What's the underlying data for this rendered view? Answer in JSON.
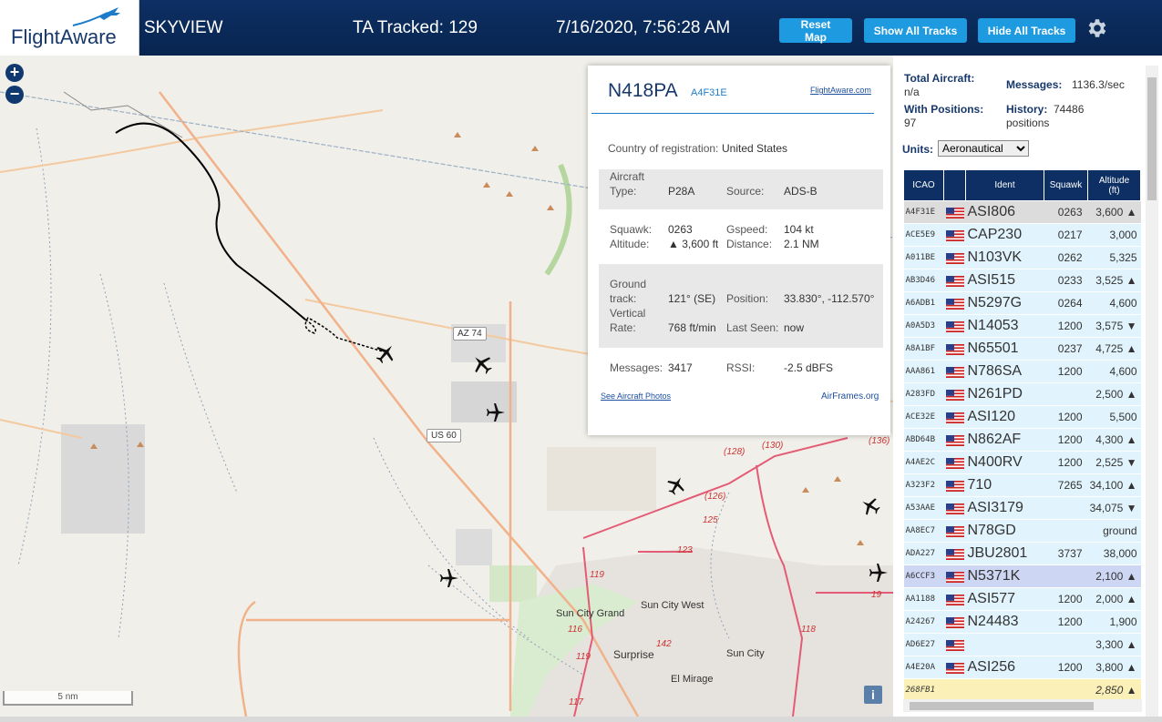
{
  "header": {
    "logo_text": "FlightAware",
    "app_title": "SKYVIEW",
    "tracked_label": "TA Tracked: 129",
    "datetime": "7/16/2020, 7:56:28 AM",
    "reset_map": "Reset Map",
    "show_all_tracks": "Show All Tracks",
    "hide_all_tracks": "Hide All Tracks",
    "settings_icon": "gear-icon"
  },
  "map": {
    "zoom_in": "+",
    "zoom_out": "−",
    "scale_label": "5 nm",
    "info_button": "i",
    "shields": [
      "AZ 74",
      "US 60"
    ],
    "route_labels": [
      "(128)",
      "(130)",
      "(136)",
      "(126)",
      "125",
      "123",
      "119",
      "116",
      "118",
      "142",
      "119",
      "117",
      "19"
    ],
    "place_labels": [
      "Sun City West",
      "Sun City Grand",
      "Surprise",
      "Sun City",
      "El Mirage"
    ]
  },
  "popup": {
    "ident": "N418PA",
    "hex": "A4F31E",
    "link": "FlightAware.com",
    "country_label": "Country of registration:",
    "country_value": "United States",
    "aircraft_type_label": "Aircraft Type:",
    "aircraft_type_l1": "Aircraft",
    "aircraft_type_l2": "Type:",
    "aircraft_type_value": "P28A",
    "source_label": "Source:",
    "source_value": "ADS-B",
    "squawk_label": "Squawk:",
    "squawk_value": "0263",
    "gspeed_label": "Gspeed:",
    "gspeed_value": "104 kt",
    "altitude_label": "Altitude:",
    "altitude_value": "▲ 3,600 ft",
    "distance_label": "Distance:",
    "distance_value": "2.1 NM",
    "track_l1": "Ground",
    "track_l2": "track:",
    "track_value": "121° (SE)",
    "position_label": "Position:",
    "position_value": "33.830°, -112.570°",
    "vrate_l1": "Vertical",
    "vrate_l2": "Rate:",
    "vrate_value": "768 ft/min",
    "last_seen_label": "Last Seen:",
    "last_seen_value": "now",
    "messages_label": "Messages:",
    "messages_value": "3417",
    "rssi_label": "RSSI:",
    "rssi_value": "-2.5 dBFS",
    "photos_link": "See Aircraft Photos",
    "airframes_link": "AirFrames.org"
  },
  "side": {
    "total_aircraft_label": "Total Aircraft:",
    "total_aircraft_value": "n/a",
    "with_positions_label": "With Positions:",
    "with_positions_value": "97",
    "messages_label": "Messages:",
    "messages_value": "1136.3/sec",
    "history_label": "History:",
    "history_value": "74486",
    "history_unit": "positions",
    "units_label": "Units:",
    "units_value": "Aeronautical",
    "columns": [
      "ICAO",
      "",
      "Ident",
      "Squawk",
      "Altitude (ft)"
    ],
    "col_alt_l1": "Altitude",
    "col_alt_l2": "(ft)",
    "rows": [
      {
        "icao": "A4F31E",
        "ident": "ASI806",
        "squawk": "0263",
        "alt": "3,600 ▲",
        "style": "sel"
      },
      {
        "icao": "ACE5E9",
        "ident": "CAP230",
        "squawk": "0217",
        "alt": "3,000",
        "style": "a"
      },
      {
        "icao": "A011BE",
        "ident": "N103VK",
        "squawk": "0262",
        "alt": "5,325",
        "style": "a"
      },
      {
        "icao": "AB3D46",
        "ident": "ASI515",
        "squawk": "0233",
        "alt": "3,525 ▲",
        "style": "a"
      },
      {
        "icao": "A6ADB1",
        "ident": "N5297G",
        "squawk": "0264",
        "alt": "4,600",
        "style": "a"
      },
      {
        "icao": "A0A5D3",
        "ident": "N14053",
        "squawk": "1200",
        "alt": "3,575 ▼",
        "style": "a"
      },
      {
        "icao": "A8A1BF",
        "ident": "N65501",
        "squawk": "0237",
        "alt": "4,725 ▲",
        "style": "a"
      },
      {
        "icao": "AAA861",
        "ident": "N786SA",
        "squawk": "1200",
        "alt": "4,600",
        "style": "a"
      },
      {
        "icao": "A283FD",
        "ident": "N261PD",
        "squawk": "",
        "alt": "2,500 ▲",
        "style": "a"
      },
      {
        "icao": "ACE32E",
        "ident": "ASI120",
        "squawk": "1200",
        "alt": "5,500",
        "style": "a"
      },
      {
        "icao": "ABD64B",
        "ident": "N862AF",
        "squawk": "1200",
        "alt": "4,300 ▲",
        "style": "a"
      },
      {
        "icao": "A4AE2C",
        "ident": "N400RV",
        "squawk": "1200",
        "alt": "2,525 ▼",
        "style": "a"
      },
      {
        "icao": "A323F2",
        "ident": "710",
        "squawk": "7265",
        "alt": "34,100 ▲",
        "style": "a"
      },
      {
        "icao": "A53AAE",
        "ident": "ASI3179",
        "squawk": "",
        "alt": "34,075 ▼",
        "style": "a"
      },
      {
        "icao": "AA8EC7",
        "ident": "N78GD",
        "squawk": "",
        "alt": "ground",
        "style": "a"
      },
      {
        "icao": "ADA227",
        "ident": "JBU2801",
        "squawk": "3737",
        "alt": "38,000",
        "style": "a"
      },
      {
        "icao": "A6CCF3",
        "ident": "N5371K",
        "squawk": "",
        "alt": "2,100 ▲",
        "style": "hl"
      },
      {
        "icao": "AA1188",
        "ident": "ASI577",
        "squawk": "1200",
        "alt": "2,000 ▲",
        "style": "a"
      },
      {
        "icao": "A24267",
        "ident": "N24483",
        "squawk": "1200",
        "alt": "1,900",
        "style": "a"
      },
      {
        "icao": "AD6E27",
        "ident": "",
        "squawk": "",
        "alt": "3,300 ▲",
        "style": "a"
      },
      {
        "icao": "A4E20A",
        "ident": "ASI256",
        "squawk": "1200",
        "alt": "3,800 ▲",
        "style": "a"
      },
      {
        "icao": "268FB1",
        "ident": "",
        "squawk": "",
        "alt": "2,850 ▲",
        "style": "y"
      }
    ]
  },
  "colors": {
    "header_bg": "#0d2f63",
    "button_bg": "#1d9ae0",
    "row_bg": "#e1f3fc",
    "row_selected": "#dcdcdc",
    "row_highlight": "#cdd6f2",
    "row_yellow": "#fbf1b8"
  }
}
